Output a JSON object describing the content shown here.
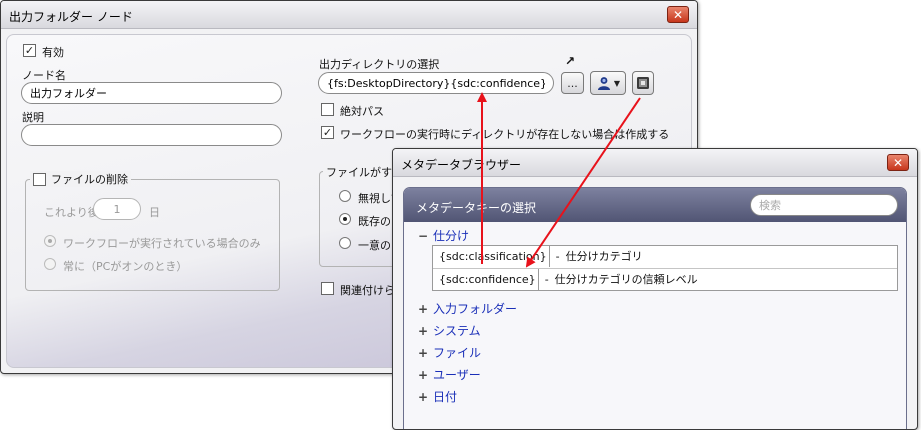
{
  "dialog": {
    "title": "出力フォルダー ノード",
    "close_glyph": "✕",
    "enabled": {
      "label": "有効",
      "checked": true
    },
    "node_name": {
      "label": "ノード名",
      "value": "出力フォルダー"
    },
    "description": {
      "label": "説明",
      "value": ""
    },
    "delete_files": {
      "label": "ファイルの削除",
      "checked": false,
      "after_prefix": "これより後",
      "days_value": "1",
      "days_unit": "日",
      "option_running": "ワークフローが実行されている場合のみ",
      "option_always": "常に（PCがオンのとき）"
    },
    "output_dir": {
      "label": "出力ディレクトリの選択",
      "value": "{fs:DesktopDirectory}{sdc:confidence}",
      "browse_label": "...",
      "expand_glyph": "↗"
    },
    "absolute_path": {
      "label": "絶対パス",
      "checked": false
    },
    "create_dir": {
      "label": "ワークフローの実行時にディレクトリが存在しない場合は作成する",
      "checked": true
    },
    "file_exists": {
      "label": "ファイルがすでに",
      "option_ignore": "無視して",
      "option_existing": "既存のフ",
      "option_unique": "一意のI"
    },
    "associate": {
      "label": "関連付けられ",
      "checked": false
    }
  },
  "metadata_browser": {
    "title": "メタデータブラウザー",
    "close_glyph": "✕",
    "panel_title": "メタデータキーの選択",
    "search_placeholder": "検索",
    "expanded_symbol": "−",
    "collapsed_symbol": "+",
    "separator": "-",
    "tree": [
      {
        "label": "仕分け",
        "expanded": true,
        "items": [
          {
            "key": "{sdc:classification}",
            "desc": "仕分けカテゴリ"
          },
          {
            "key": "{sdc:confidence}",
            "desc": "仕分けカテゴリの信頼レベル"
          }
        ]
      },
      {
        "label": "入力フォルダー",
        "expanded": false
      },
      {
        "label": "システム",
        "expanded": false
      },
      {
        "label": "ファイル",
        "expanded": false
      },
      {
        "label": "ユーザー",
        "expanded": false
      },
      {
        "label": "日付",
        "expanded": false
      }
    ]
  },
  "colors": {
    "arrow": "#e8121b",
    "tree_link": "#1a2fb8",
    "close_button": "#c7361c",
    "panel_header": "#5d617f"
  }
}
